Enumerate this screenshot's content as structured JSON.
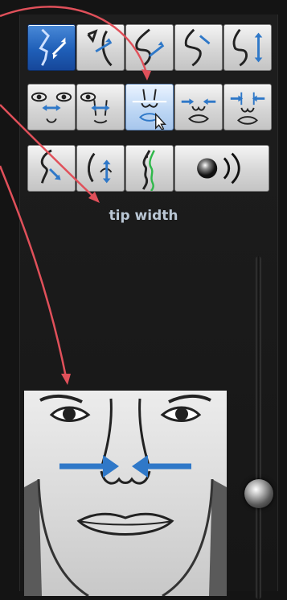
{
  "feature_label": "tip width",
  "toolbar": {
    "row1": [
      {
        "name": "nose-profile-tool",
        "state": "active"
      },
      {
        "name": "forehead-nose-angle-tool",
        "state": "normal"
      },
      {
        "name": "nose-projection-tool",
        "state": "normal"
      },
      {
        "name": "nose-dorsum-tool",
        "state": "normal"
      },
      {
        "name": "nose-length-tool",
        "state": "normal"
      }
    ],
    "row2": [
      {
        "name": "eye-distance-tool",
        "state": "normal"
      },
      {
        "name": "bridge-width-tool",
        "state": "normal"
      },
      {
        "name": "tip-width-tool",
        "state": "hovered"
      },
      {
        "name": "nostril-width-tool",
        "state": "normal"
      },
      {
        "name": "base-width-tool",
        "state": "normal"
      }
    ],
    "row3": [
      {
        "name": "chin-profile-tool",
        "state": "normal"
      },
      {
        "name": "lip-profile-tool",
        "state": "normal"
      },
      {
        "name": "profile-outline-tool",
        "state": "normal"
      },
      {
        "name": "sound-preview-tool",
        "state": "normal"
      }
    ]
  },
  "colors": {
    "accent": "#1f5fb8",
    "annotation": "#e0505a",
    "arrow": "#2f78c8"
  },
  "slider": {
    "value": 0.7
  }
}
